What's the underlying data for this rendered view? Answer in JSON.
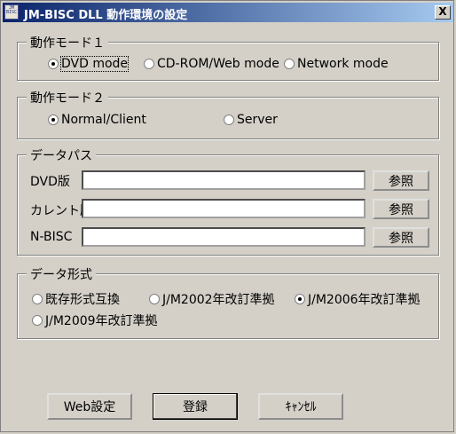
{
  "window": {
    "title": "JM-BISC DLL 動作環境の設定",
    "icon_text": "JM BISC",
    "close_label": "X"
  },
  "mode1": {
    "legend": "動作モード１",
    "options": [
      "DVD mode",
      "CD-ROM/Web mode",
      "Network mode"
    ],
    "selected": "DVD mode"
  },
  "mode2": {
    "legend": "動作モード２",
    "options": [
      "Normal/Client",
      "Server"
    ],
    "selected": "Normal/Client"
  },
  "datapath": {
    "legend": "データパス",
    "rows": [
      {
        "label": "DVD版",
        "value": "",
        "button": "参照"
      },
      {
        "label": "カレント版",
        "value": "",
        "button": "参照"
      },
      {
        "label": "N-BISC",
        "value": "",
        "button": "参照"
      }
    ]
  },
  "format": {
    "legend": "データ形式",
    "options": [
      "既存形式互換",
      "J/M2002年改訂準拠",
      "J/M2006年改訂準拠",
      "J/M2009年改訂準拠"
    ],
    "selected": "J/M2006年改訂準拠"
  },
  "buttons": {
    "web": "Web設定",
    "register": "登録",
    "cancel": "ｷｬﾝｾﾙ"
  }
}
